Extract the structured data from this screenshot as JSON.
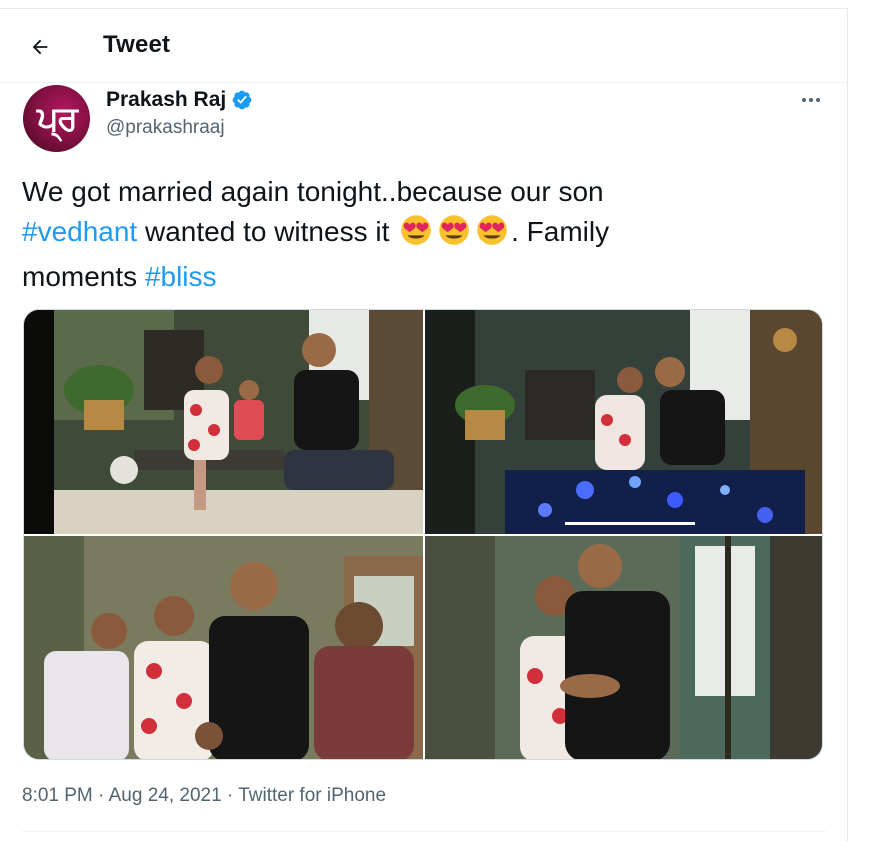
{
  "header": {
    "title": "Tweet",
    "back_icon": "arrow-left-icon"
  },
  "author": {
    "display_name": "Prakash Raj",
    "handle": "@prakashraaj",
    "verified_icon": "verified-badge-icon",
    "avatar_text": "ਪ੍ਰ"
  },
  "tweet": {
    "line1": "We got married again tonight..because our son",
    "hashtag1": "#vedhant",
    "line2": " wanted to witness it ",
    "emojis": [
      "😍",
      "😍",
      "😍"
    ],
    "line3": ". Family",
    "line4": "moments ",
    "hashtag2": "#bliss"
  },
  "media": {
    "photos": [
      {
        "name": "photo-family-ring-exchange"
      },
      {
        "name": "photo-couple-kiss"
      },
      {
        "name": "photo-family-group"
      },
      {
        "name": "photo-couple-embrace"
      }
    ]
  },
  "meta": {
    "time": "8:01 PM",
    "separator": "·",
    "date": "Aug 24, 2021",
    "source": "Twitter for iPhone"
  },
  "colors": {
    "link": "#1d9bf0",
    "verified": "#1d9bf0",
    "secondary_text": "#536471"
  }
}
